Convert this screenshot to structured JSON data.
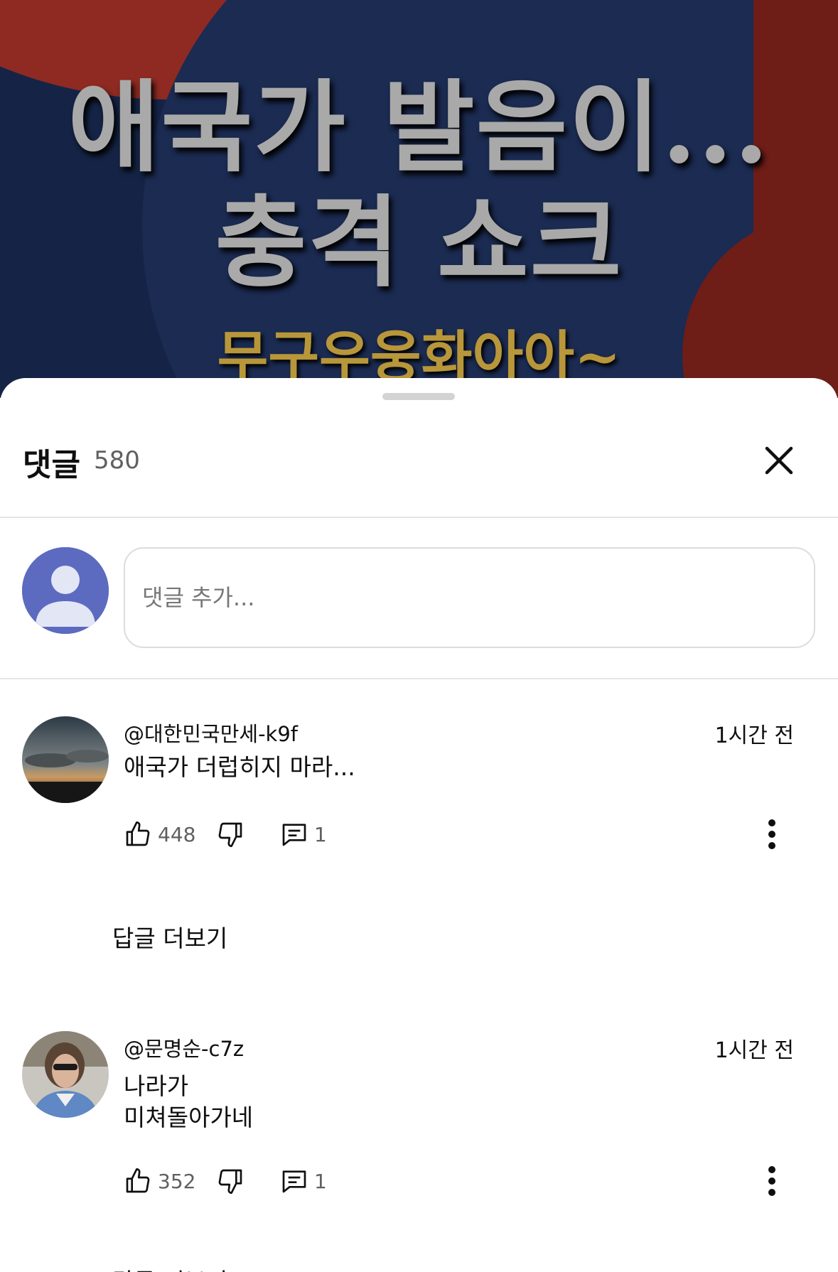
{
  "video": {
    "title_line1": "애국가 발음이...",
    "title_line2": "충격 쇼크",
    "subtitle": "무구우웅화아아~"
  },
  "comments_panel": {
    "title": "댓글",
    "count": "580",
    "close_icon": "close-icon",
    "composer": {
      "placeholder": "댓글 추가...",
      "avatar_color": "#5c6bc0"
    }
  },
  "comments": [
    {
      "author": "@대한민국만세-k9f",
      "time": "1시간 전",
      "text_lines": [
        "애국가 더럽히지 마라..."
      ],
      "likes": "448",
      "replies": "1",
      "view_replies_label": "답글 더보기"
    },
    {
      "author": "@문명순-c7z",
      "time": "1시간 전",
      "text_lines": [
        "나라가",
        "미쳐돌아가네"
      ],
      "likes": "352",
      "replies": "1",
      "view_replies_label": "답글 더보기"
    }
  ]
}
